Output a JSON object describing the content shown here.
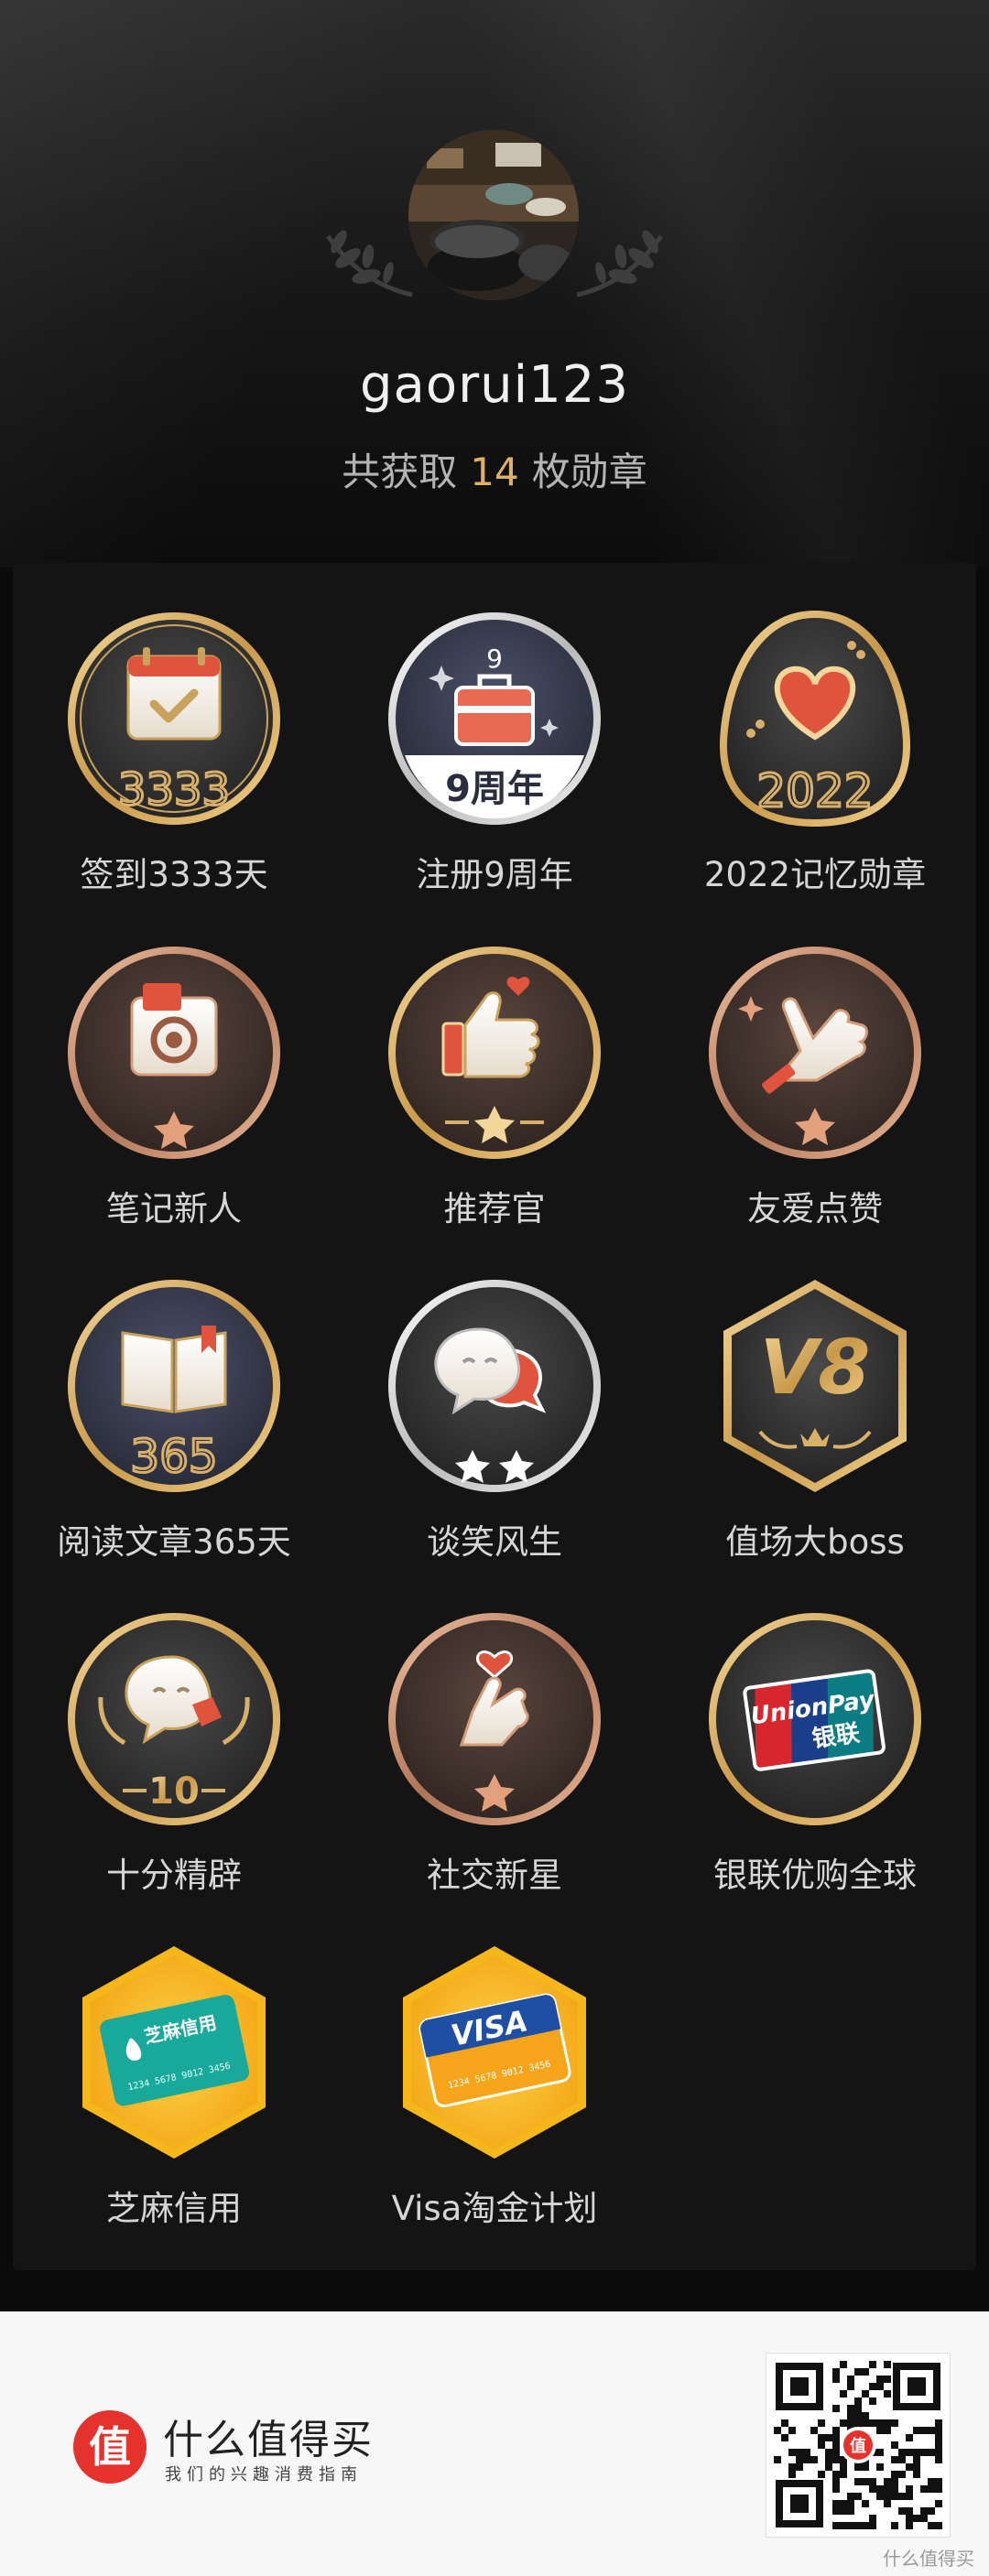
{
  "profile": {
    "username": "gaorui123",
    "summary_prefix": "共获取",
    "badge_count": "14",
    "summary_suffix": "枚勋章"
  },
  "badges": [
    {
      "label": "签到3333天",
      "icon": "calendar-check-icon"
    },
    {
      "label": "注册9周年",
      "icon": "toolbox-anniversary-icon",
      "badge_text": "9周年"
    },
    {
      "label": "2022记忆勋章",
      "icon": "heart-egg-icon"
    },
    {
      "label": "笔记新人",
      "icon": "camera-icon"
    },
    {
      "label": "推荐官",
      "icon": "thumbs-up-icon"
    },
    {
      "label": "友爱点赞",
      "icon": "hand-like-icon"
    },
    {
      "label": "阅读文章365天",
      "icon": "book-icon"
    },
    {
      "label": "谈笑风生",
      "icon": "chat-bubbles-icon"
    },
    {
      "label": "值场大boss",
      "icon": "v8-hexagon-icon",
      "badge_text": "V8"
    },
    {
      "label": "十分精辟",
      "icon": "chat-laurel-icon",
      "badge_text": "10"
    },
    {
      "label": "社交新星",
      "icon": "finger-heart-icon"
    },
    {
      "label": "银联优购全球",
      "icon": "unionpay-icon",
      "badge_text": "UnionPay",
      "badge_subtext": "银联"
    },
    {
      "label": "芝麻信用",
      "icon": "sesame-credit-card-icon",
      "badge_text": "芝麻信用",
      "badge_subtext": "1234 5678 9012 3456"
    },
    {
      "label": "Visa淘金计划",
      "icon": "visa-card-icon",
      "badge_text": "VISA",
      "badge_subtext": "1234 5678 9012 3456"
    }
  ],
  "footer": {
    "logo_char": "值",
    "brand_name": "什么值得买",
    "slogan": "我们的兴趣消费指南",
    "watermark": "什么值得买"
  },
  "colors": {
    "gold": "#d9b06a",
    "accent_count": "#e0b066",
    "brand_red": "#e5322d",
    "panel_bg": "#141414"
  }
}
